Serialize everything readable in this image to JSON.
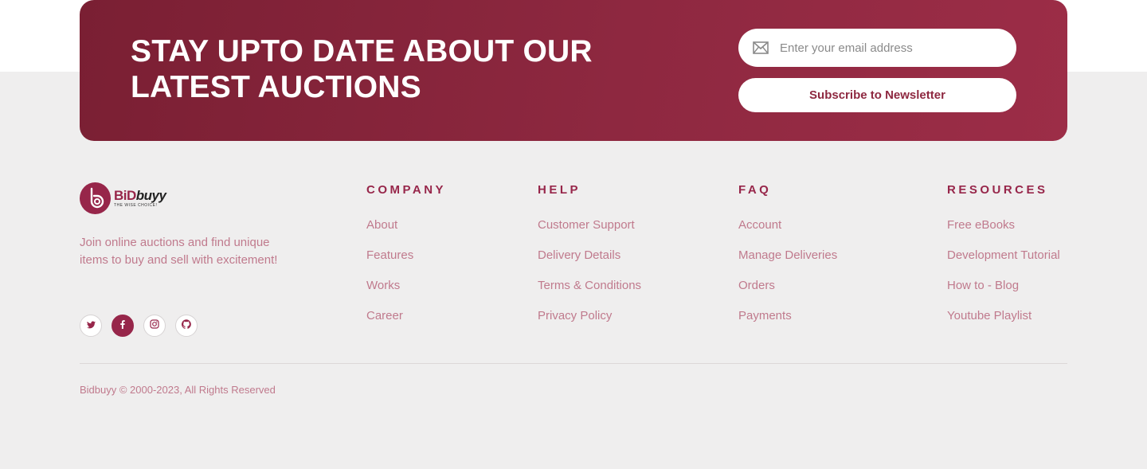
{
  "newsletter": {
    "title": "STAY UPTO DATE ABOUT OUR LATEST AUCTIONS",
    "email_placeholder": "Enter your email address",
    "subscribe_label": "Subscribe to Newsletter"
  },
  "brand": {
    "logo_word_1": "BiD",
    "logo_word_2": "buyy",
    "logo_tagline": "THE WISE CHOICE!",
    "description": "Join online auctions and find unique items to buy and sell with excitement!",
    "socials": [
      "twitter-icon",
      "facebook-icon",
      "instagram-icon",
      "github-icon"
    ]
  },
  "columns": [
    {
      "title": "COMPANY",
      "links": [
        "About",
        "Features",
        "Works",
        "Career"
      ]
    },
    {
      "title": "HELP",
      "links": [
        "Customer Support",
        "Delivery Details",
        "Terms & Conditions",
        "Privacy Policy"
      ]
    },
    {
      "title": "FAQ",
      "links": [
        "Account",
        "Manage Deliveries",
        "Orders",
        "Payments"
      ]
    },
    {
      "title": "RESOURCES",
      "links": [
        "Free eBooks",
        "Development Tutorial",
        "How to - Blog",
        "Youtube Playlist"
      ]
    }
  ],
  "copyright": "Bidbuyy © 2000-2023, All Rights Reserved",
  "colors": {
    "accent": "#97264a",
    "link": "#c07a8d",
    "background": "#efeeee"
  }
}
